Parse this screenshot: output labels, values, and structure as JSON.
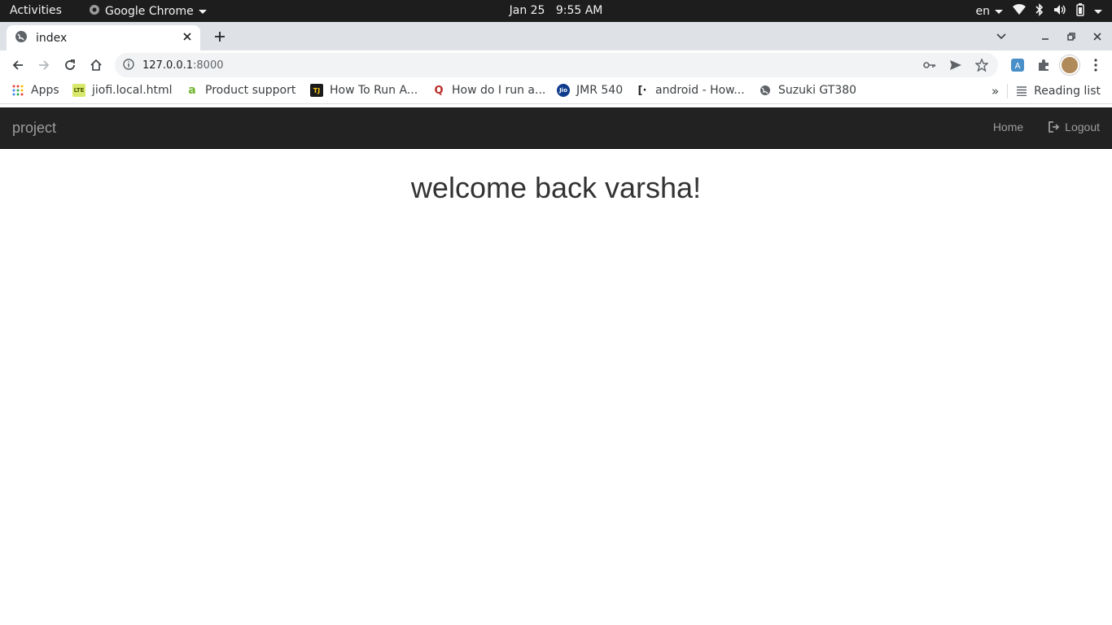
{
  "system_bar": {
    "activities": "Activities",
    "app_name": "Google Chrome",
    "date": "Jan 25",
    "time": "9:55 AM",
    "language": "en",
    "tray_icons": [
      "wifi-icon",
      "bluetooth-icon",
      "volume-icon",
      "battery-icon"
    ]
  },
  "browser": {
    "tab": {
      "title": "index"
    },
    "omnibox": {
      "host": "127.0.0.1",
      "port": ":8000"
    },
    "bookmarks": [
      {
        "label": "Apps",
        "icon": "apps-grid-icon"
      },
      {
        "label": "jiofi.local.html",
        "icon": "lte-icon"
      },
      {
        "label": "Product support",
        "icon": "a-logo-icon"
      },
      {
        "label": "How To Run A...",
        "icon": "tj-icon"
      },
      {
        "label": "How do I run a...",
        "icon": "quora-icon"
      },
      {
        "label": "JMR 540",
        "icon": "jio-icon"
      },
      {
        "label": "android - How...",
        "icon": "bracket-icon"
      },
      {
        "label": "Suzuki GT380",
        "icon": "globe-icon"
      }
    ],
    "reading_list": "Reading list",
    "colors": {
      "tabstrip": "#dee1e6",
      "omnibox": "#f1f3f4"
    }
  },
  "site": {
    "brand": "project",
    "nav": {
      "home": "Home",
      "logout": "Logout"
    },
    "heading": "welcome back varsha!",
    "colors": {
      "navbar": "#222222",
      "nav_text": "#9d9d9d",
      "heading": "#333333"
    }
  }
}
